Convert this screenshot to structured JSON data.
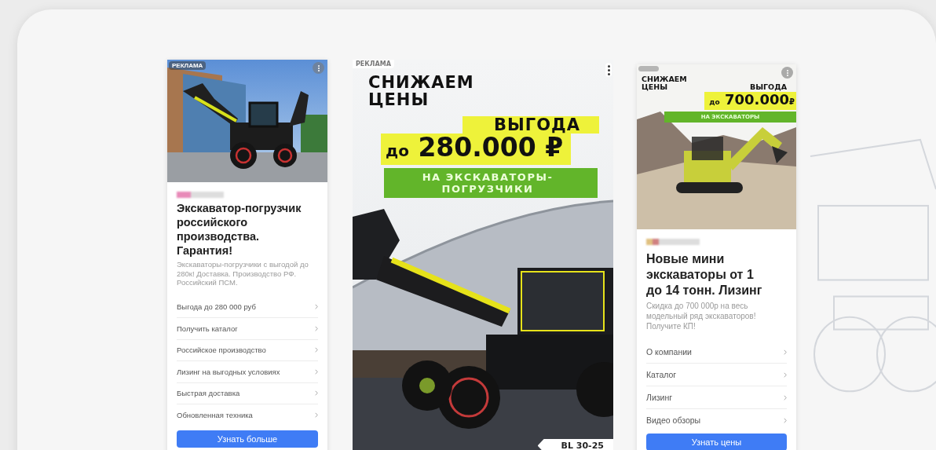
{
  "ads": [
    {
      "kind": "standard",
      "ad_label": "РЕКЛАМА",
      "title": "Экскаватор-погрузчик российского производства. Гарантия!",
      "description": "Экскаваторы-погрузчики с выгодой до 280к! Доставка. Производство РФ. Российский ПСМ.",
      "links": [
        "Выгода до 280 000 руб",
        "Получить каталог",
        "Российское производство",
        "Лизинг на выгодных условиях",
        "Быстрая доставка",
        "Обновленная техника"
      ],
      "button": "Узнать больше"
    },
    {
      "kind": "banner",
      "ad_label": "РЕКЛАМА",
      "banner": {
        "headline": "СНИЖАЕМ ЦЕНЫ",
        "benefit": "ВЫГОДА",
        "amount_prefix": "до",
        "amount": "280.000",
        "currency": "₽",
        "target": "НА ЭКСКАВАТОРЫ-ПОГРУЗЧИКИ"
      },
      "model_label": "BL 30-25"
    },
    {
      "kind": "standard",
      "banner": {
        "headline": "СНИЖАЕМ ЦЕНЫ",
        "benefit": "ВЫГОДА",
        "amount_prefix": "до",
        "amount": "700.000",
        "currency": "₽",
        "target": "НА ЭКСКАВАТОРЫ"
      },
      "title": "Новые мини экскаваторы от 1 до 14 тонн. Лизинг",
      "description": "Скидка до 700 000р на весь модельный ряд экскаваторов! Получите КП!",
      "links": [
        "О компании",
        "Каталог",
        "Лизинг",
        "Видео обзоры"
      ],
      "button": "Узнать цены"
    }
  ]
}
